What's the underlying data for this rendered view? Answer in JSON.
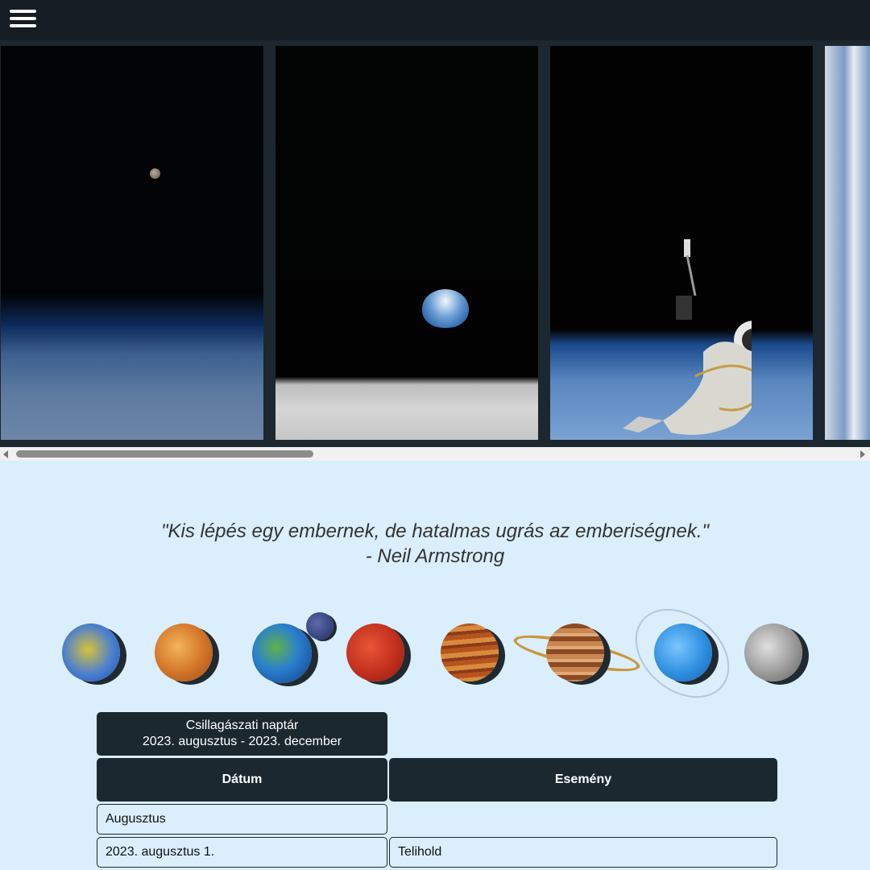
{
  "gallery": {
    "photos": [
      "earth-horizon-moon",
      "earthrise",
      "spacewalk-astronaut",
      "earth-clouds"
    ]
  },
  "quote": {
    "text": "\"Kis lépés egy embernek, de hatalmas ugrás az emberiségnek.\"",
    "author": "- Neil Armstrong"
  },
  "planets": [
    "Merkúr",
    "Vénusz",
    "Föld",
    "Hold",
    "Mars",
    "Jupiter",
    "Szaturnusz",
    "Uránusz",
    "Neptunusz"
  ],
  "calendar": {
    "title_line1": "Csillagászati naptár",
    "title_line2": "2023. augusztus - 2023. december",
    "headers": {
      "date": "Dátum",
      "event": "Esemény"
    },
    "rows": [
      {
        "date": "Augusztus",
        "event": ""
      },
      {
        "date": "2023. augusztus 1.",
        "event": "Telihold"
      }
    ]
  },
  "colors": {
    "nav_bg": "#151c24",
    "page_bg": "#daeefb",
    "header_bg": "#1b2830"
  }
}
